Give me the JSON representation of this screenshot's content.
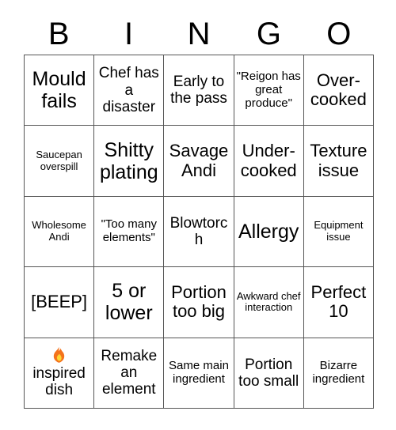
{
  "card": {
    "title_letters": [
      "B",
      "I",
      "N",
      "G",
      "O"
    ],
    "rows": [
      [
        {
          "text": "Mould fails",
          "size": "xl"
        },
        {
          "text": "Chef has a disaster",
          "size": "md"
        },
        {
          "text": "Early to the pass",
          "size": "md"
        },
        {
          "text": "\"Reigon has great produce\"",
          "size": "sm"
        },
        {
          "text": "Over-cooked",
          "size": "lg"
        }
      ],
      [
        {
          "text": "Saucepan overspill",
          "size": "xs"
        },
        {
          "text": "Shitty plating",
          "size": "xl"
        },
        {
          "text": "Savage Andi",
          "size": "lg"
        },
        {
          "text": "Under-cooked",
          "size": "lg"
        },
        {
          "text": "Texture issue",
          "size": "lg"
        }
      ],
      [
        {
          "text": "Wholesome Andi",
          "size": "xs"
        },
        {
          "text": "\"Too many elements\"",
          "size": "sm"
        },
        {
          "text": "Blowtorch",
          "size": "md"
        },
        {
          "text": "Allergy",
          "size": "xl"
        },
        {
          "text": "Equipment issue",
          "size": "xs"
        }
      ],
      [
        {
          "text": "[BEEP]",
          "size": "lg"
        },
        {
          "text": "5 or lower",
          "size": "xl"
        },
        {
          "text": "Portion too big",
          "size": "lg"
        },
        {
          "text": "Awkward chef interaction",
          "size": "xs"
        },
        {
          "text": "Perfect 10",
          "size": "lg"
        }
      ],
      [
        {
          "text": "inspired dish",
          "size": "md",
          "icon": "fire-emoji",
          "icon_colors": {
            "outer": "#F4731C",
            "inner": "#FDD835"
          }
        },
        {
          "text": "Remake an element",
          "size": "md"
        },
        {
          "text": "Same main ingredient",
          "size": "sm"
        },
        {
          "text": "Portion too small",
          "size": "md"
        },
        {
          "text": "Bizarre ingredient",
          "size": "sm"
        }
      ]
    ]
  },
  "colors": {
    "background": "#ffffff",
    "text": "#000000",
    "grid_line": "#555555"
  }
}
